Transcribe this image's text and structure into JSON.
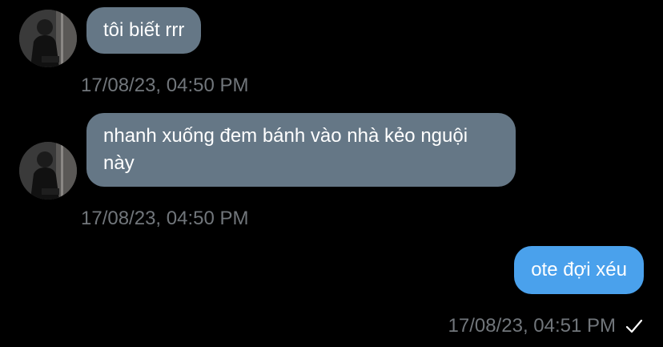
{
  "colors": {
    "background": "#000000",
    "received_bubble": "#657786",
    "sent_bubble": "#4aa1ec",
    "timestamp": "#71767b"
  },
  "messages": [
    {
      "direction": "received",
      "text": "tôi biết rrr",
      "time": "17/08/23, 04:50 PM",
      "avatar_icon": "profile-photo-icon"
    },
    {
      "direction": "received",
      "text": "nhanh xuống đem bánh vào nhà kẻo nguội này",
      "time": "17/08/23, 04:50 PM",
      "avatar_icon": "profile-photo-icon"
    },
    {
      "direction": "sent",
      "text": "ote đợi xéu",
      "time": "17/08/23, 04:51 PM",
      "status_icon": "checkmark-icon"
    }
  ]
}
